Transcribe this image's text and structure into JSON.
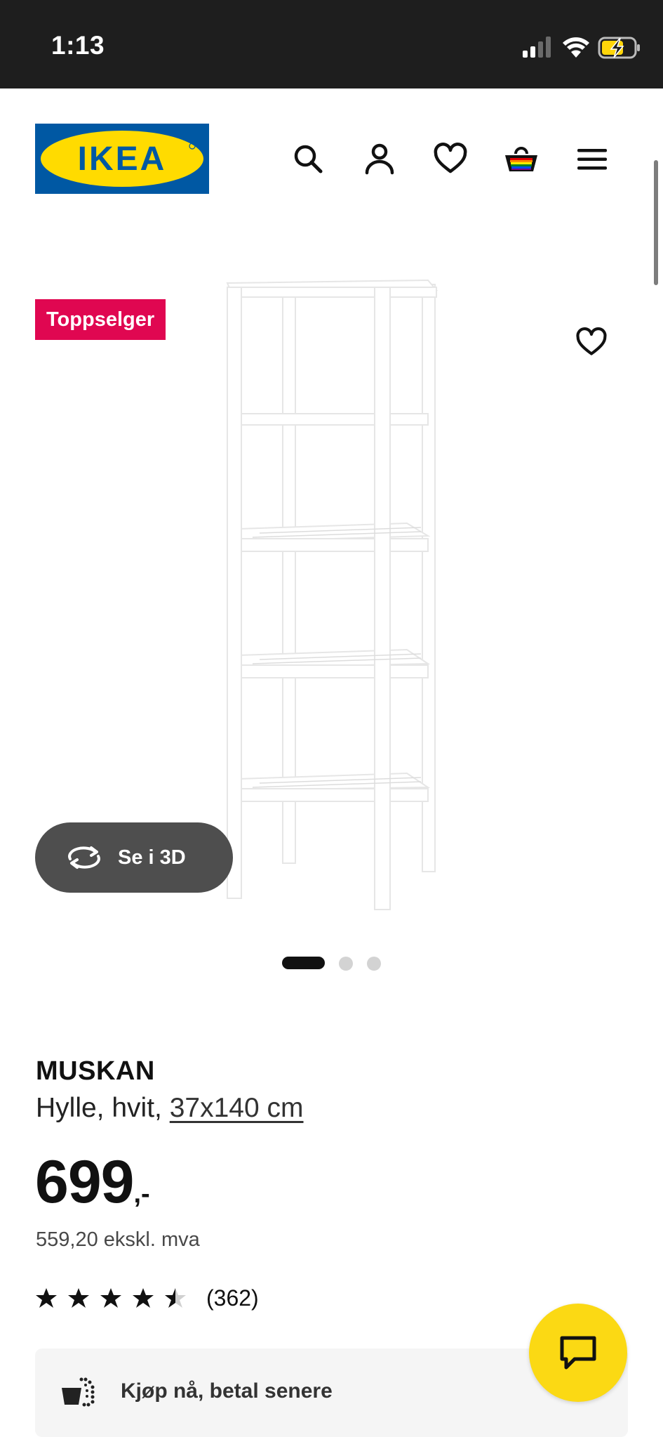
{
  "status_bar": {
    "time": "1:13"
  },
  "header": {
    "logo_text": "IKEA",
    "icons": [
      "search-icon",
      "account-icon",
      "heart-icon",
      "basket-icon",
      "menu-icon"
    ],
    "brand_colors": {
      "blue": "#0058a3",
      "yellow": "#ffdb00"
    }
  },
  "product_image": {
    "badge": "Toppselger",
    "view_3d_label": "Se i 3D",
    "carousel": {
      "total": 3,
      "active": 1
    }
  },
  "product": {
    "name": "MUSKAN",
    "description": "Hylle, hvit,",
    "size": "37x140 cm",
    "price_integer": "699",
    "price_suffix": ",-",
    "price_excl_vat": "559,20 ekskl. mva",
    "rating": 4.5,
    "rating_count": "(362)"
  },
  "klarna": {
    "label": "Kjøp nå, betal senere"
  },
  "colors": {
    "badge": "#e00751",
    "chat_button": "#fbd914",
    "btn_3d": "#4e4e4e"
  }
}
